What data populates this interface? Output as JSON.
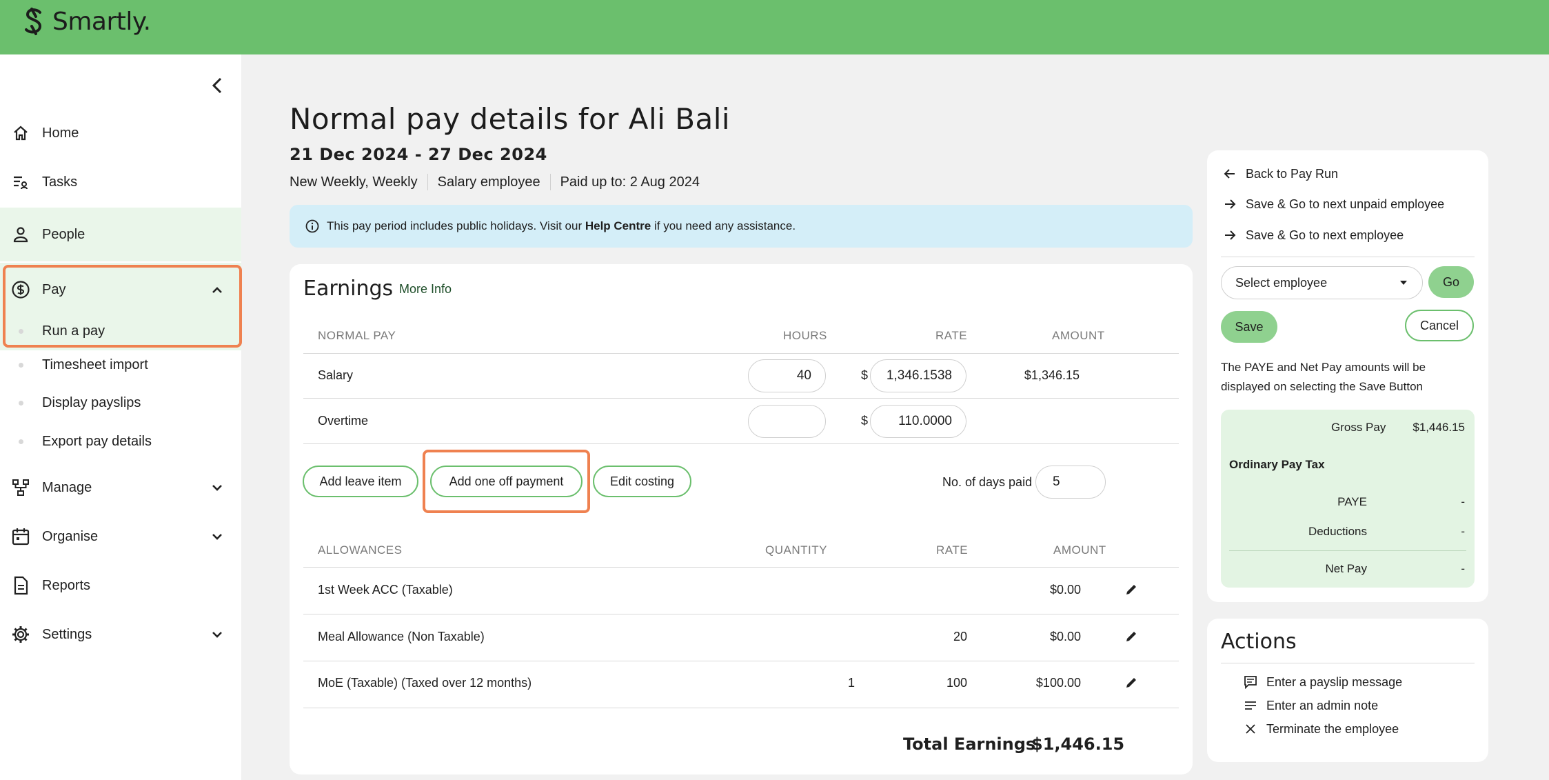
{
  "app": {
    "name": "Smartly."
  },
  "sidebar": {
    "items": [
      {
        "label": "Home",
        "icon": "home-icon"
      },
      {
        "label": "Tasks",
        "icon": "tasks-icon"
      },
      {
        "label": "People",
        "icon": "person-icon"
      },
      {
        "label": "Pay",
        "icon": "dollar-circle-icon"
      },
      {
        "label": "Manage",
        "icon": "hierarchy-icon"
      },
      {
        "label": "Organise",
        "icon": "calendar-icon"
      },
      {
        "label": "Reports",
        "icon": "document-icon"
      },
      {
        "label": "Settings",
        "icon": "gear-icon"
      }
    ],
    "pay_subitems": [
      "Run a pay",
      "Timesheet import",
      "Display payslips",
      "Export pay details"
    ]
  },
  "header": {
    "title": "Normal pay details for Ali Bali",
    "period": "21 Dec 2024 - 27 Dec 2024",
    "meta": [
      "New Weekly, Weekly",
      "Salary employee",
      "Paid up to: 2 Aug 2024"
    ]
  },
  "notice": {
    "prefix": "This pay period includes public holidays. Visit our ",
    "link": "Help Centre",
    "suffix": " if you need any assistance."
  },
  "earnings": {
    "title": "Earnings",
    "more_info": "More Info",
    "normal_pay": {
      "headers": [
        "NORMAL PAY",
        "HOURS",
        "RATE",
        "AMOUNT"
      ],
      "rows": [
        {
          "name": "Salary",
          "hours": "40",
          "currency": "$",
          "rate": "1,346.1538",
          "amount": "$1,346.15"
        },
        {
          "name": "Overtime",
          "hours": "",
          "currency": "$",
          "rate": "110.0000",
          "amount": ""
        }
      ]
    },
    "buttons": {
      "add_leave": "Add leave item",
      "add_one_off": "Add one off payment",
      "edit_costing": "Edit costing"
    },
    "days_paid_label": "No. of days paid",
    "days_paid_value": "5",
    "allowances": {
      "headers": [
        "ALLOWANCES",
        "QUANTITY",
        "RATE",
        "AMOUNT"
      ],
      "rows": [
        {
          "name": "1st Week ACC (Taxable)",
          "quantity": "",
          "rate": "",
          "amount": "$0.00"
        },
        {
          "name": "Meal Allowance (Non Taxable)",
          "quantity": "",
          "rate": "20",
          "amount": "$0.00"
        },
        {
          "name": "MoE (Taxable) (Taxed over 12 months)",
          "quantity": "1",
          "rate": "100",
          "amount": "$100.00"
        }
      ]
    },
    "total_label": "Total Earnings",
    "total_value": "$1,446.15"
  },
  "side_panel": {
    "links": [
      "Back to Pay Run",
      "Save & Go to next unpaid employee",
      "Save & Go to next employee"
    ],
    "select_placeholder": "Select employee",
    "go": "Go",
    "save": "Save",
    "cancel": "Cancel",
    "note": "The PAYE and Net Pay amounts will be displayed on selecting the Save Button",
    "summary": {
      "gross_label": "Gross Pay",
      "gross_value": "$1,446.15",
      "section": "Ordinary Pay Tax",
      "paye_label": "PAYE",
      "paye_value": "-",
      "deductions_label": "Deductions",
      "deductions_value": "-",
      "net_label": "Net Pay",
      "net_value": "-"
    }
  },
  "actions": {
    "title": "Actions",
    "items": [
      "Enter a payslip message",
      "Enter an admin note",
      "Terminate the employee"
    ]
  },
  "colors": {
    "brand_green": "#6bbf6d",
    "highlight_orange": "#ef8150",
    "notice_blue": "#d4eef8"
  }
}
